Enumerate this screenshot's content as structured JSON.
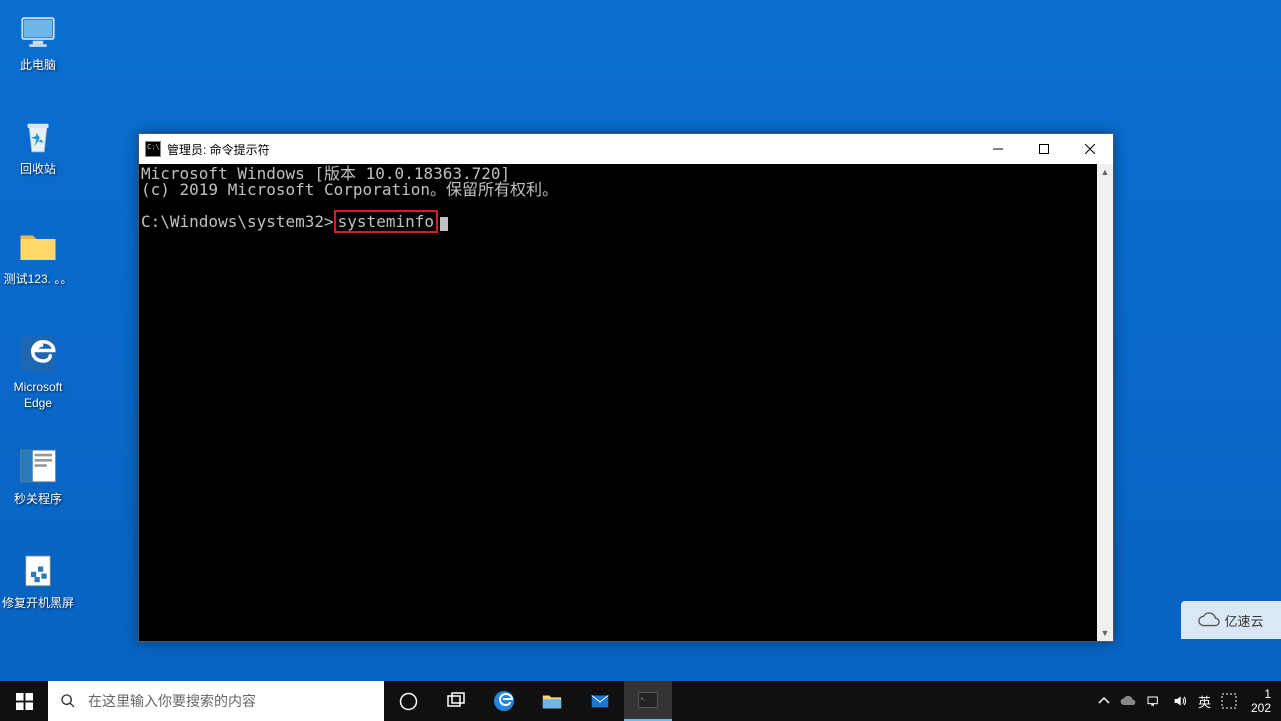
{
  "desktop_icons": {
    "this_pc": "此电脑",
    "recycle_bin": "回收站",
    "test_folder": "测试123. 。。",
    "edge": "Microsoft Edge",
    "seconds_off": "秒关程序",
    "repair_boot": "修复开机黑屏"
  },
  "cmd": {
    "title": "管理员: 命令提示符",
    "version_line": "Microsoft Windows [版本 10.0.18363.720]",
    "copyright_line": "(c) 2019 Microsoft Corporation。保留所有权利。",
    "prompt": "C:\\Windows\\system32>",
    "command": "systeminfo",
    "after_command": "_"
  },
  "taskbar": {
    "search_placeholder": "在这里输入你要搜索的内容",
    "ime_lang": "英",
    "time": "1",
    "date": "202"
  },
  "watermark": {
    "text": "亿速云"
  }
}
